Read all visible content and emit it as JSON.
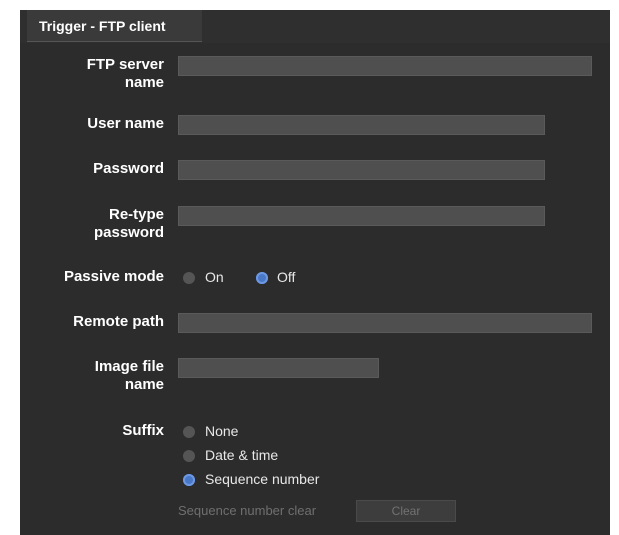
{
  "tab": {
    "title": "Trigger - FTP client"
  },
  "form": {
    "ftp_server_name": {
      "label_line1": "FTP server",
      "label_line2": "name",
      "value": ""
    },
    "user_name": {
      "label": "User name",
      "value": ""
    },
    "password": {
      "label": "Password",
      "value": ""
    },
    "retype_password": {
      "label_line1": "Re-type",
      "label_line2": "password",
      "value": ""
    },
    "passive_mode": {
      "label": "Passive mode",
      "options": [
        "On",
        "Off"
      ],
      "selected": "Off"
    },
    "remote_path": {
      "label": "Remote path",
      "value": ""
    },
    "image_file_name": {
      "label_line1": "Image file",
      "label_line2": "name",
      "value": ""
    },
    "suffix": {
      "label": "Suffix",
      "options": [
        "None",
        "Date & time",
        "Sequence number"
      ],
      "selected": "Sequence number"
    },
    "sequence_clear": {
      "label": "Sequence number clear",
      "button": "Clear"
    }
  },
  "colors": {
    "background": "#2c2c2c",
    "field": "#4f4f4f",
    "radio_selected": "#4a78c8"
  }
}
